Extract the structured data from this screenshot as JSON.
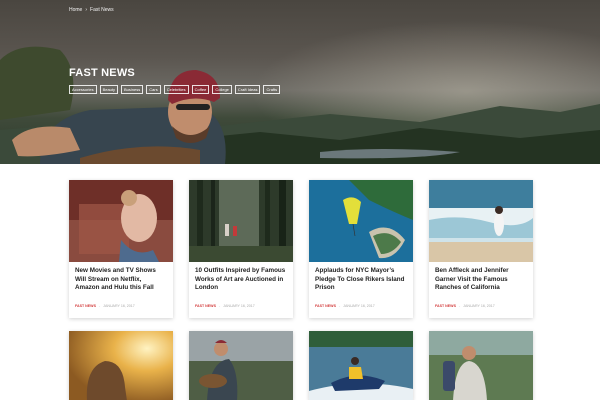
{
  "breadcrumb": {
    "home": "Home",
    "separator": "›",
    "current": "Fast News"
  },
  "hero": {
    "title": "FAST NEWS",
    "tags": [
      "Accessories",
      "Beauty",
      "Business",
      "Cars",
      "Celebrities",
      "Coffee",
      "College",
      "Craft Ideas",
      "Crafts"
    ]
  },
  "cards": [
    {
      "title": "New Movies and TV Shows Will Stream on Netflix, Amazon and Hulu this Fall",
      "category": "Fast News",
      "date": "January 16, 2017"
    },
    {
      "title": "10 Outfits Inspired by Famous Works of Art are Auctioned in London",
      "category": "Fast News",
      "date": "January 16, 2017"
    },
    {
      "title": "Applauds for NYC Mayor’s Pledge To Close Rikers Island Prison",
      "category": "Fast News",
      "date": "January 16, 2017"
    },
    {
      "title": "Ben Affleck and Jennifer Garner Visit the Famous Ranches of California",
      "category": "Fast News",
      "date": "January 16, 2017"
    }
  ],
  "meta_separator": "-",
  "colors": {
    "accent": "#d23b3b",
    "title": "#222222"
  }
}
